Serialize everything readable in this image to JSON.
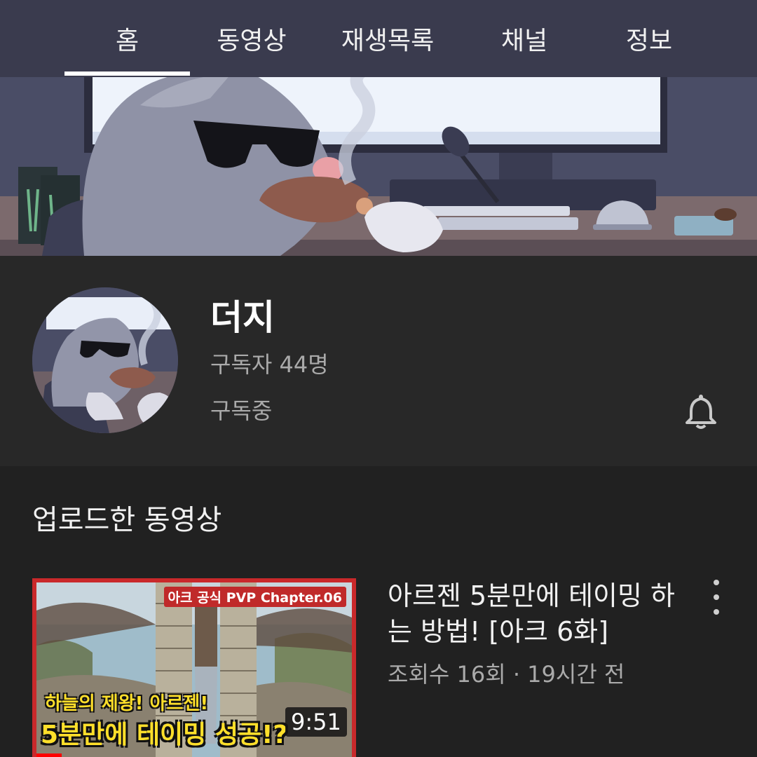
{
  "tabs": [
    {
      "label": "홈"
    },
    {
      "label": "동영상"
    },
    {
      "label": "재생목록"
    },
    {
      "label": "채널"
    },
    {
      "label": "정보"
    }
  ],
  "active_tab": "홈",
  "channel": {
    "name": "더지",
    "subscribers": "구독자 44명",
    "subscription_status": "구독중",
    "bell_icon": "bell-icon"
  },
  "uploads": {
    "section_title": "업로드한 동영상",
    "videos": [
      {
        "thumbnail_badge": "아크 공식 PVP Chapter.06",
        "thumbnail_line1": "하늘의 제왕! 아르젠!",
        "thumbnail_line2": "5분만에 테이밍 성공!?",
        "duration": "9:51",
        "title": "아르젠 5분만에 테이밍 하는 방법! [아크 6화]",
        "meta": "조회수 16회 · 19시간 전",
        "menu_icon": "more-vert-icon"
      }
    ]
  },
  "colors": {
    "tab_bar": "#3a3b4e",
    "info_background": "#282828",
    "page_background": "#212121",
    "thumbnail_border": "#c9292b",
    "thumbnail_text": "#ffdf2a",
    "secondary_text": "#aaaaaa"
  }
}
